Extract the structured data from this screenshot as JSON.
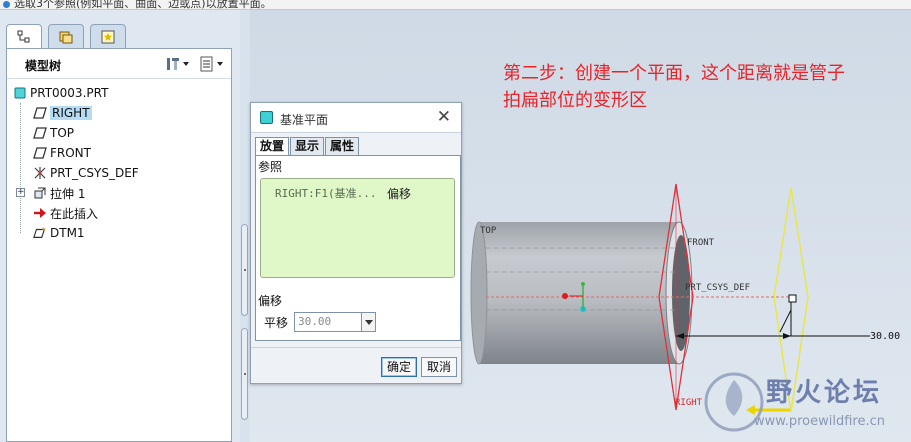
{
  "status": {
    "message": "选取3个参照(例如平面、曲面、边或点)以放置平面。"
  },
  "left_panel": {
    "tabs": [
      {
        "name": "model-tree-tab",
        "active": true
      },
      {
        "name": "folder-browser-tab",
        "active": false
      },
      {
        "name": "favorites-tab",
        "active": false
      }
    ],
    "title": "模型树"
  },
  "tree": {
    "root": "PRT0003.PRT",
    "items": [
      {
        "label": "RIGHT",
        "icon": "datum-plane-icon",
        "selected": true
      },
      {
        "label": "TOP",
        "icon": "datum-plane-icon"
      },
      {
        "label": "FRONT",
        "icon": "datum-plane-icon"
      },
      {
        "label": "PRT_CSYS_DEF",
        "icon": "coordinate-system-icon"
      },
      {
        "label": "拉伸 1",
        "icon": "extrude-icon",
        "expandable": true
      },
      {
        "label": "在此插入",
        "icon": "insert-here-arrow-icon"
      },
      {
        "label": "DTM1",
        "icon": "new-datum-plane-icon"
      }
    ]
  },
  "annotation": {
    "line1": "第二步：创建一个平面，这个距离就是管子",
    "line2": "拍扁部位的变形区"
  },
  "viewport": {
    "labels": {
      "top": "TOP",
      "front": "FRONT",
      "csys": "PRT_CSYS_DEF",
      "right": "RIGHT",
      "dimension": "30.00"
    },
    "colors": {
      "right_plane": "#e0303a",
      "new_plane": "#e8e64a",
      "tube": "#b8bcc2"
    }
  },
  "dialog": {
    "title": "基准平面",
    "tabs": [
      "放置",
      "显示",
      "属性"
    ],
    "reference_section": "参照",
    "reference_item": "RIGHT:F1(基准...",
    "reference_type": "偏移",
    "offset_section": "偏移",
    "translate_label": "平移",
    "translate_value": "30.00",
    "ok_label": "确定",
    "cancel_label": "取消"
  },
  "watermark": {
    "title": "野火论坛",
    "url": "www.proewildfire.cn"
  }
}
